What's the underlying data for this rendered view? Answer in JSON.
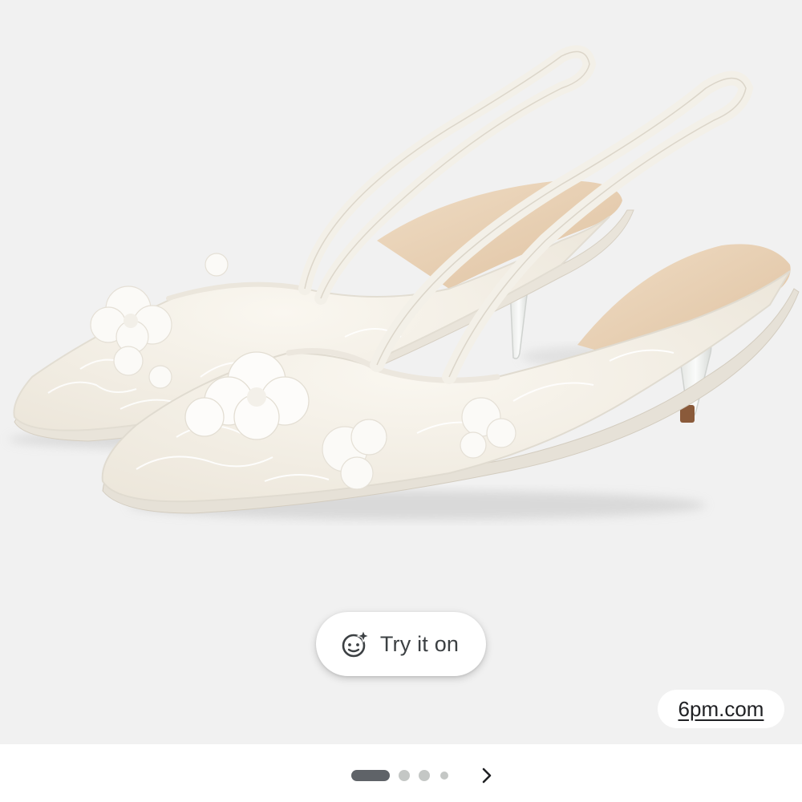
{
  "product_image": {
    "alt": "White lace floral slingback kitten heel pumps"
  },
  "try_on": {
    "label": "Try it on",
    "icon": "face-sparkle-icon"
  },
  "source": {
    "label": "6pm.com"
  },
  "carousel": {
    "total_pages": 4,
    "current_page": 1,
    "next_icon": "chevron-right-icon"
  },
  "colors": {
    "background": "#f1f1f1",
    "active_dot": "#5f6368",
    "inactive_dot": "#c4c7c5",
    "shoe": "#f7f5ef",
    "insole": "#e9d3b8"
  }
}
